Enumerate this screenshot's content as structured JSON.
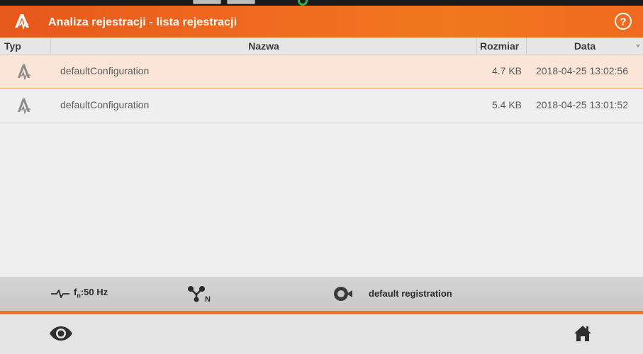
{
  "header": {
    "title": "Analiza rejestracji - lista rejestracji"
  },
  "table": {
    "columns": {
      "typ": "Typ",
      "nazwa": "Nazwa",
      "rozmiar": "Rozmiar",
      "data": "Data"
    },
    "rows": [
      {
        "name": "defaultConfiguration",
        "size": "4.7 KB",
        "date": "2018-04-25 13:02:56",
        "selected": true,
        "icon": "recording-wave-icon"
      },
      {
        "name": "defaultConfiguration",
        "size": "5.4 KB",
        "date": "2018-04-25 13:01:52",
        "selected": false,
        "icon": "recording-wave-icon"
      }
    ]
  },
  "status": {
    "frequency_prefix": "f",
    "frequency_sub": "n",
    "frequency_value": ":50 Hz",
    "network_icon": "network-topology-icon",
    "registration_label": "default registration"
  },
  "toolbar": {
    "left_icon": "eye-icon",
    "right_icon": "home-icon"
  },
  "colors": {
    "accent": "#ee7322",
    "selected_row": "#fbe5d7"
  }
}
